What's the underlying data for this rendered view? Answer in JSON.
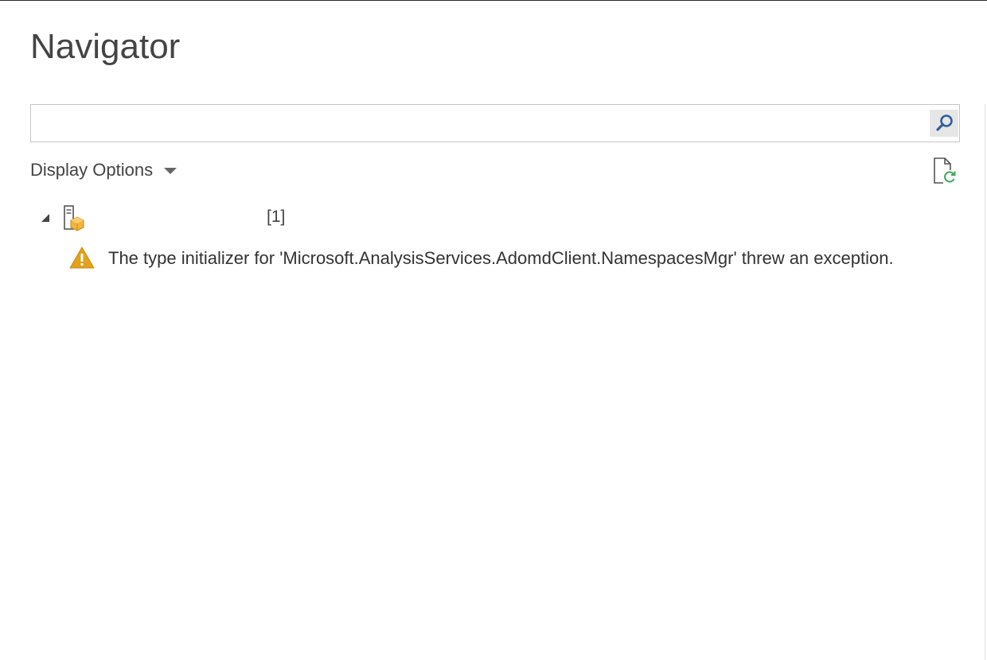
{
  "window": {
    "title": "Navigator"
  },
  "search": {
    "value": "",
    "placeholder": "",
    "button_icon": "search-icon"
  },
  "toolbar": {
    "display_options_label": "Display Options",
    "display_options_icon": "chevron-down-icon",
    "refresh_icon": "refresh-document-icon"
  },
  "tree": {
    "root": {
      "expanded": true,
      "icon": "analysis-server-icon",
      "name": "",
      "count_label": "[1]"
    },
    "children": [
      {
        "icon": "warning-icon",
        "message": "The type initializer for 'Microsoft.AnalysisServices.AdomdClient.NamespacesMgr' threw an exception."
      }
    ]
  },
  "colors": {
    "warning": "#e3a21a",
    "refresh_accent": "#3aa655",
    "search_icon": "#2f5f9e",
    "server_icon_accent": "#f0b53c"
  }
}
